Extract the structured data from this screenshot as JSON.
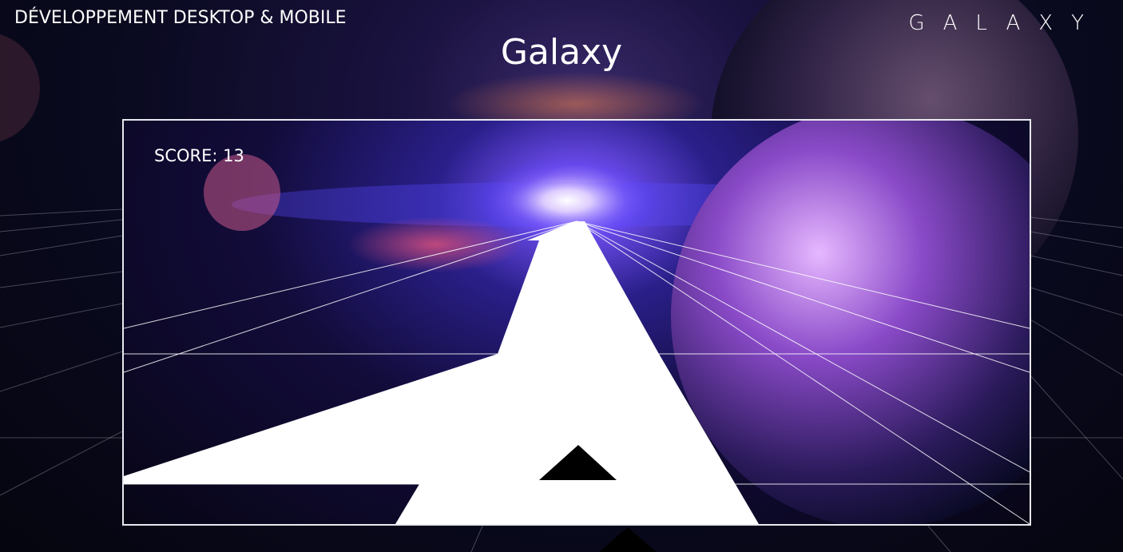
{
  "header": {
    "left_label": "DÉVELOPPEMENT DESKTOP & MOBILE",
    "right_label": "GALAXY"
  },
  "title": "Galaxy",
  "game": {
    "score_label": "SCORE:",
    "score_value": "13"
  },
  "colors": {
    "track": "#ffffff",
    "grid_lines": "#ffffff",
    "ship": "#000000",
    "frame_border": "#e8e8f0"
  }
}
